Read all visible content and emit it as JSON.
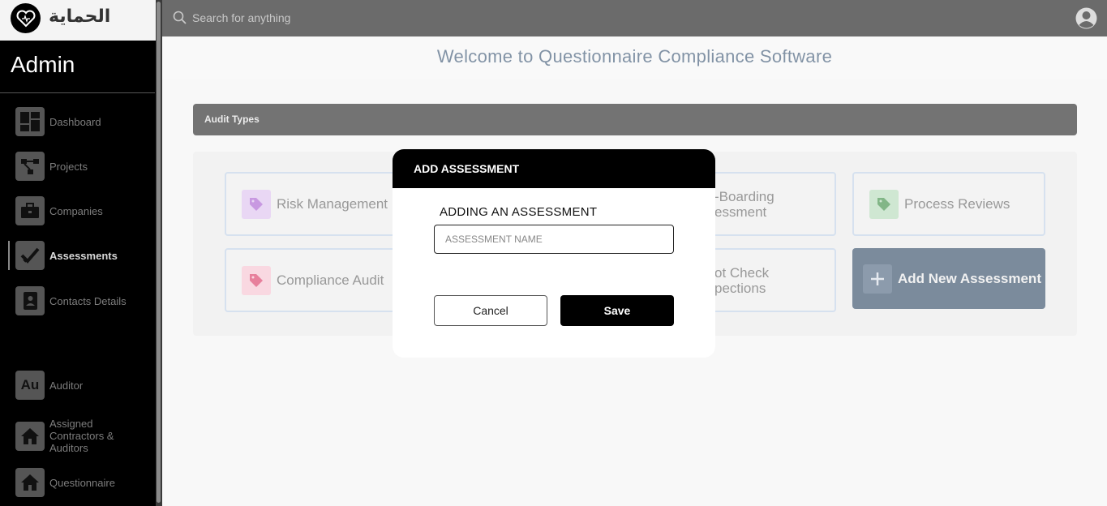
{
  "brand": {
    "logo_text": "الحماية"
  },
  "sidebar": {
    "title": "Admin",
    "items": [
      {
        "label": "Dashboard",
        "icon": "dashboard-icon"
      },
      {
        "label": "Projects",
        "icon": "projects-icon"
      },
      {
        "label": "Companies",
        "icon": "briefcase-icon"
      },
      {
        "label": "Assessments",
        "icon": "checkmark-icon",
        "active": true
      },
      {
        "label": "Contacts Details",
        "icon": "contact-book-icon"
      },
      {
        "label": "Auditor",
        "icon": "au-icon",
        "icon_text": "Au"
      },
      {
        "label": "Assigned Contractors & Auditors",
        "icon": "home-icon"
      },
      {
        "label": "Questionnaire",
        "icon": "home-icon"
      }
    ]
  },
  "topbar": {
    "search_placeholder": "Search for anything"
  },
  "main": {
    "welcome": "Welcome to Questionnaire Compliance Software",
    "audit_header": "Audit Types",
    "cards": [
      {
        "label": "Risk Management",
        "tag_color": "#b56fd8"
      },
      {
        "label": "-Boarding\nessment",
        "tag_color": "#3a8a3a"
      },
      {
        "label": "Process Reviews",
        "tag_color": "#2e9a3a"
      },
      {
        "label": "Compliance Audit",
        "tag_color": "#e0436a"
      },
      {
        "label": "ot Check\npections",
        "tag_color": "#999999"
      },
      {
        "label": "Add New Assessment",
        "icon": "plus-icon"
      }
    ]
  },
  "modal": {
    "title": "ADD ASSESSMENT",
    "subtitle": "ADDING AN ASSESSMENT",
    "input_placeholder": "ASSESSMENT NAME",
    "cancel_label": "Cancel",
    "save_label": "Save"
  },
  "colors": {
    "accent_dark": "#0f2c4c",
    "welcome_text": "#1a3a5c"
  }
}
